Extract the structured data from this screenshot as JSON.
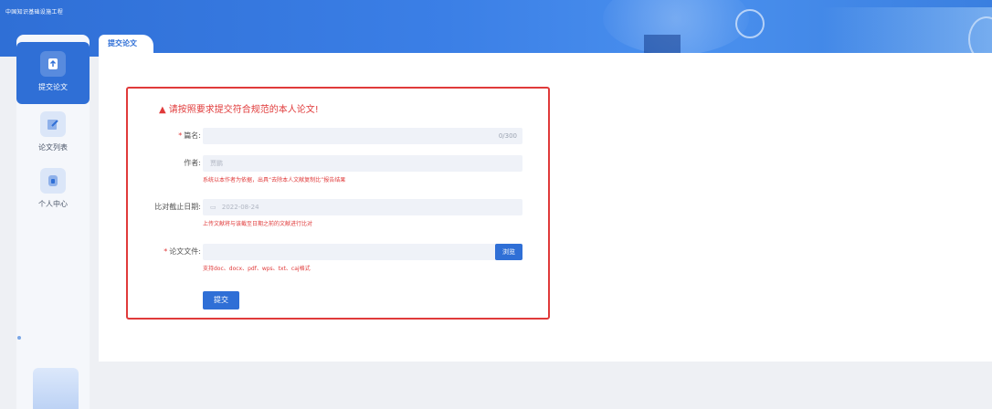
{
  "header": {
    "brand": "中国知识基础设施工程"
  },
  "sidebar": {
    "items": [
      {
        "label": "提交论文",
        "icon": "upload-doc-icon",
        "active": true
      },
      {
        "label": "论文列表",
        "icon": "edit-list-icon",
        "active": false
      },
      {
        "label": "个人中心",
        "icon": "user-center-icon",
        "active": false
      }
    ]
  },
  "tabs": [
    {
      "label": "提交论文"
    }
  ],
  "form": {
    "warning": "请按照要求提交符合规范的本人论文!",
    "title": {
      "label": "篇名:",
      "value": "",
      "counter": "0/300"
    },
    "author": {
      "label": "作者:",
      "value": "贾鹏",
      "hint": "系统以本作者为依据，出具“去除本人文献复制比”报告结果"
    },
    "deadline": {
      "label": "比对截止日期:",
      "value": "2022-08-24",
      "hint": "上传文献将与该截至日期之前的文献进行比对"
    },
    "file": {
      "label": "论文文件:",
      "value": "",
      "browse": "浏览",
      "hint": "支持doc、docx、pdf、wps、txt、caj格式"
    },
    "submit": "提交"
  },
  "colors": {
    "primary": "#2f6fd6",
    "warning": "#e03a3a"
  }
}
